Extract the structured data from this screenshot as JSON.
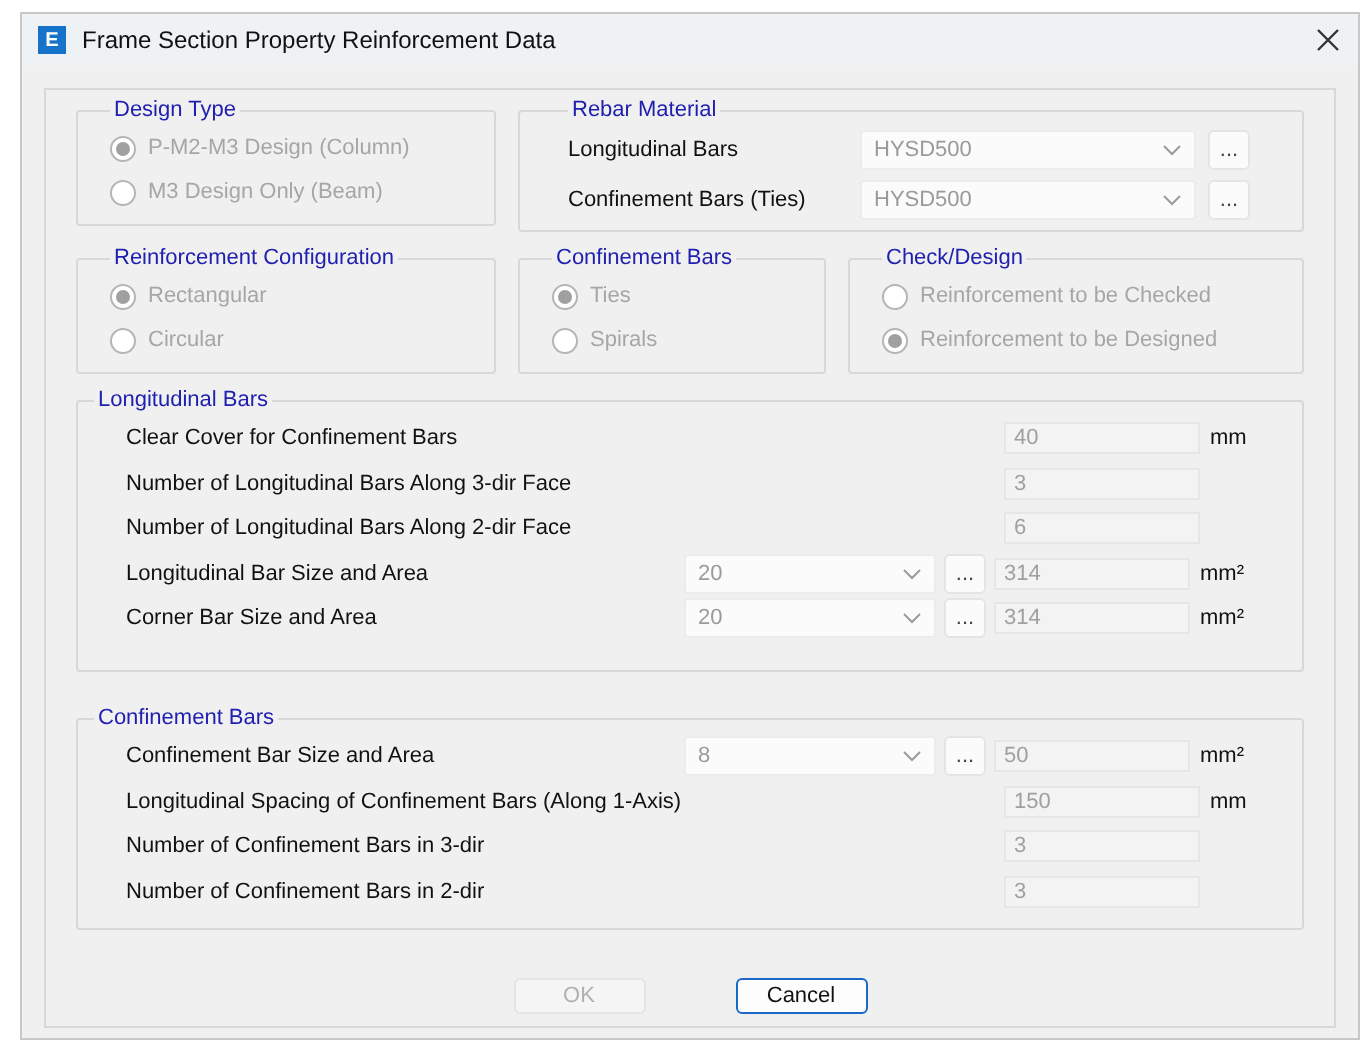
{
  "window": {
    "icon_letter": "E",
    "title": "Frame Section Property Reinforcement Data"
  },
  "design_type": {
    "title": "Design Type",
    "disabled": true,
    "options": [
      {
        "label": "P-M2-M3 Design  (Column)",
        "selected": true
      },
      {
        "label": "M3 Design Only  (Beam)",
        "selected": false
      }
    ]
  },
  "rebar_material": {
    "title": "Rebar Material",
    "rows": [
      {
        "label": "Longitudinal Bars",
        "value": "HYSD500",
        "button": "..."
      },
      {
        "label": "Confinement Bars (Ties)",
        "value": "HYSD500",
        "button": "..."
      }
    ]
  },
  "reinforcement_configuration": {
    "title": "Reinforcement Configuration",
    "disabled": true,
    "options": [
      {
        "label": "Rectangular",
        "selected": true
      },
      {
        "label": "Circular",
        "selected": false
      }
    ]
  },
  "confinement_bars_type": {
    "title": "Confinement Bars",
    "disabled": true,
    "options": [
      {
        "label": "Ties",
        "selected": true
      },
      {
        "label": "Spirals",
        "selected": false
      }
    ]
  },
  "check_design": {
    "title": "Check/Design",
    "disabled": true,
    "options": [
      {
        "label": "Reinforcement to be Checked",
        "selected": false
      },
      {
        "label": "Reinforcement to be Designed",
        "selected": true
      }
    ]
  },
  "longitudinal_bars": {
    "title": "Longitudinal Bars",
    "rows": [
      {
        "kind": "field",
        "label": "Clear Cover for Confinement Bars",
        "value": "40",
        "unit": "mm"
      },
      {
        "kind": "field",
        "label": "Number of Longitudinal Bars Along 3-dir Face",
        "value": "3"
      },
      {
        "kind": "field",
        "label": "Number of Longitudinal Bars Along 2-dir Face",
        "value": "6"
      },
      {
        "kind": "combo",
        "label": "Longitudinal Bar Size and Area",
        "combo_value": "20",
        "button": "...",
        "value": "314",
        "unit": "mm²"
      },
      {
        "kind": "combo",
        "label": "Corner Bar Size and Area",
        "combo_value": "20",
        "button": "...",
        "value": "314",
        "unit": "mm²"
      }
    ]
  },
  "confinement_bars": {
    "title": "Confinement Bars",
    "rows": [
      {
        "kind": "combo",
        "label": "Confinement Bar Size and Area",
        "combo_value": "8",
        "button": "...",
        "value": "50",
        "unit": "mm²"
      },
      {
        "kind": "field",
        "label": "Longitudinal Spacing of Confinement Bars  (Along 1-Axis)",
        "value": "150",
        "unit": "mm"
      },
      {
        "kind": "field",
        "label": "Number of Confinement Bars in 3-dir",
        "value": "3"
      },
      {
        "kind": "field",
        "label": "Number of Confinement Bars in 2-dir",
        "value": "3"
      }
    ]
  },
  "buttons": [
    {
      "label": "OK",
      "disabled": true,
      "default": false
    },
    {
      "label": "Cancel",
      "disabled": false,
      "default": true
    }
  ]
}
